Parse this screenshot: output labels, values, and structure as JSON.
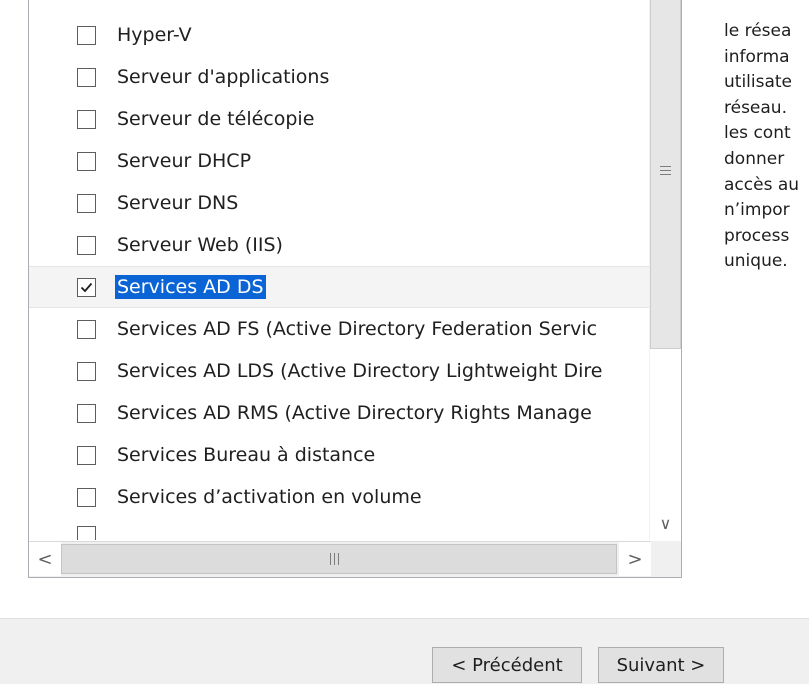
{
  "roles": [
    {
      "label": "Hyper-V",
      "checked": false
    },
    {
      "label": "Serveur d'applications",
      "checked": false
    },
    {
      "label": "Serveur de télécopie",
      "checked": false
    },
    {
      "label": "Serveur DHCP",
      "checked": false
    },
    {
      "label": "Serveur DNS",
      "checked": false
    },
    {
      "label": "Serveur Web (IIS)",
      "checked": false
    },
    {
      "label": "Services AD DS",
      "checked": true
    },
    {
      "label": "Services AD FS (Active Directory Federation Servic",
      "checked": false
    },
    {
      "label": "Services AD LDS (Active Directory Lightweight Dire",
      "checked": false
    },
    {
      "label": "Services AD RMS (Active Directory Rights Manage",
      "checked": false
    },
    {
      "label": "Services Bureau à distance",
      "checked": false
    },
    {
      "label": "Services d’activation en volume",
      "checked": false
    }
  ],
  "description_lines": [
    "le résea",
    "informa",
    "utilisate",
    "réseau.",
    "les cont",
    "donner",
    "accès au",
    "n’impor",
    "process",
    "unique."
  ],
  "scrollbar": {
    "grip_glyph": "≡",
    "down_arrow": "∨",
    "left_arrow": "<",
    "right_arrow": ">",
    "h_grip_glyph": "|||"
  },
  "footer": {
    "previous_label": "< Précédent",
    "next_label": "Suivant >"
  },
  "colors": {
    "selection": "#0a64d6",
    "footer_bg": "#f0f0f0"
  }
}
